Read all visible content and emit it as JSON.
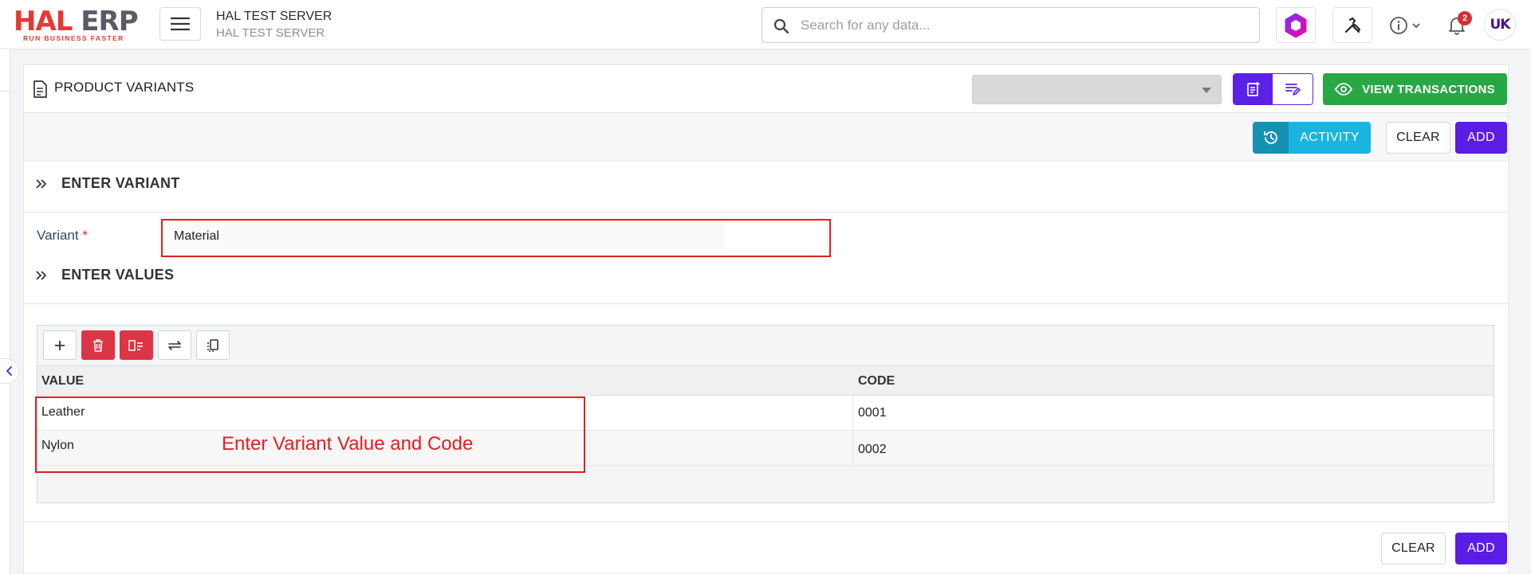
{
  "app": {
    "logo_primary": "HAL",
    "logo_secondary": "ERP",
    "logo_tagline": "RUN BUSINESS FASTER",
    "server_name": "HAL TEST SERVER",
    "server_subtitle": "HAL TEST SERVER",
    "search_placeholder": "Search for any data...",
    "notification_count": "2",
    "user_initials": "UK"
  },
  "page": {
    "title": "PRODUCT VARIANTS",
    "view_transactions_label": "VIEW TRANSACTIONS",
    "activity_label": "ACTIVITY",
    "clear_label": "CLEAR",
    "add_label": "ADD"
  },
  "variant_section": {
    "title": "ENTER VARIANT",
    "field_label": "Variant",
    "required_mark": "*",
    "field_value": "Material"
  },
  "values_section": {
    "title": "ENTER VALUES",
    "columns": [
      "VALUE",
      "CODE"
    ],
    "rows": [
      {
        "value": "Leather",
        "code": "0001"
      },
      {
        "value": "Nylon",
        "code": "0002"
      }
    ]
  },
  "annotation": "Enter Variant Value and Code",
  "colors": {
    "primary_purple": "#5b1de6",
    "success_green": "#28a745",
    "activity_blue": "#1ab4e0",
    "danger_red": "#dc3545",
    "annotation_red": "#e02020"
  },
  "icons": {
    "menu": "hamburger-icon",
    "search": "search-icon",
    "app": "hexagon-app-icon",
    "tools": "tools-icon",
    "info": "info-icon",
    "notifications": "bell-icon"
  }
}
